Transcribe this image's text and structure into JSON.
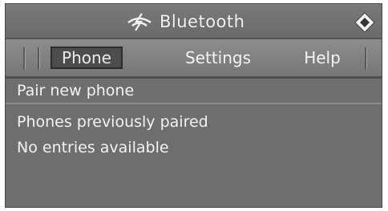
{
  "window": {
    "title": "Bluetooth"
  },
  "tabs": [
    {
      "label": "Phone",
      "active": true
    },
    {
      "label": "Settings",
      "active": false
    },
    {
      "label": "Help",
      "active": false
    }
  ],
  "list": {
    "pair_new_label": "Pair new phone",
    "section_header": "Phones previously paired",
    "empty_message": "No entries available"
  },
  "icons": {
    "title_icon": "bluetooth-icon",
    "nav_icon": "controller-direction-icon"
  },
  "colors": {
    "background": "#6e6e6e",
    "text": "#f2f2f2",
    "active_tab": "#4d4d4d"
  }
}
